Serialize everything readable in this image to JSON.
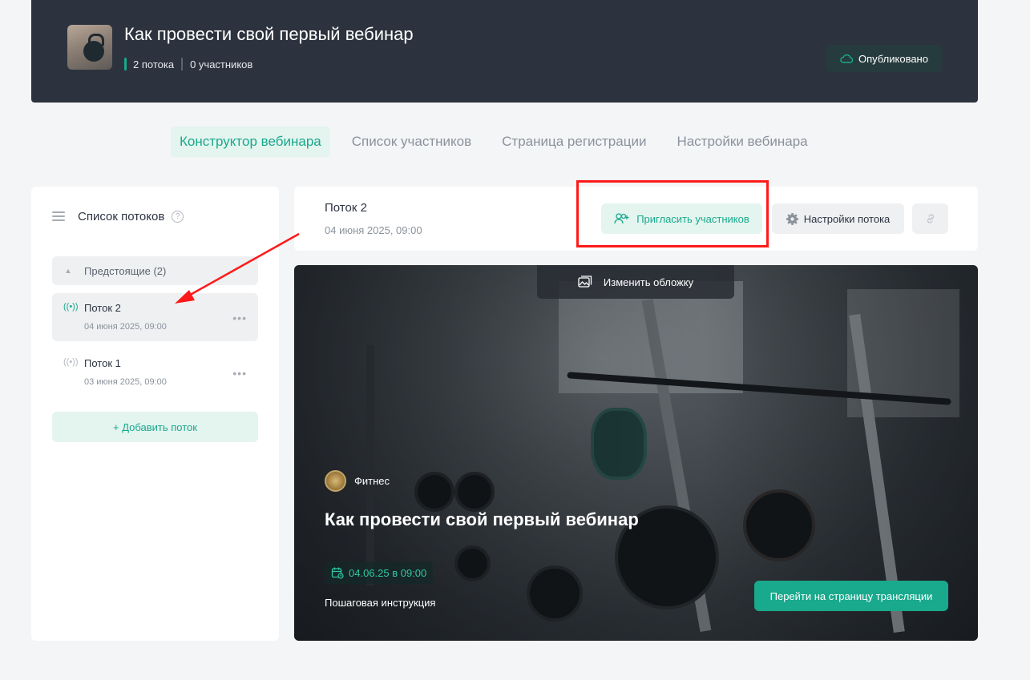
{
  "header": {
    "title": "Как провести свой первый вебинар",
    "streams_count": "2 потока",
    "participants_count": "0 участников",
    "status_label": "Опубликовано"
  },
  "tabs": [
    {
      "label": "Конструктор вебинара",
      "active": true
    },
    {
      "label": "Список участников",
      "active": false
    },
    {
      "label": "Страница регистрации",
      "active": false
    },
    {
      "label": "Настройки вебинара",
      "active": false
    }
  ],
  "sidebar": {
    "title": "Список потоков",
    "help_icon": "question-icon",
    "group_label": "Предстоящие (2)",
    "streams": [
      {
        "name": "Поток 2",
        "date": "04 июня 2025, 09:00",
        "active": true
      },
      {
        "name": "Поток 1",
        "date": "03 июня 2025, 09:00",
        "active": false
      }
    ],
    "add_label": "+ Добавить поток"
  },
  "stream_panel": {
    "name": "Поток 2",
    "date": "04 июня 2025, 09:00",
    "invite_label": "Пригласить участников",
    "settings_label": "Настройки потока",
    "link_icon": "link-icon"
  },
  "cover": {
    "change_cover_label": "Изменить обложку",
    "category": "Фитнес",
    "title": "Как провести свой первый вебинар",
    "date": "04.06.25 в 09:00",
    "instruction": "Пошаговая инструкция",
    "go_label": "Перейти на страницу трансляции"
  },
  "colors": {
    "accent": "#19a98c",
    "header_bg": "#2c333e",
    "annotation": "#ff1a1a"
  }
}
